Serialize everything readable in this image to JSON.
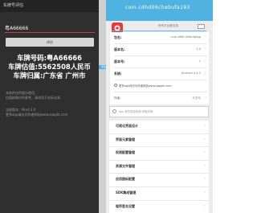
{
  "left_app": {
    "title": "车牌号评估",
    "plate_input_value": "粤A66666",
    "evaluate_button": "评估",
    "result_plate": "车牌号码:粤A66666",
    "result_value": "车牌估值:5562508人民币",
    "result_region": "车牌归属:广东省 广州市",
    "disclaimer": [
      "本软件仅供娱乐使用，",
      "估值结果仅供参考，请勿用于实际交易"
    ],
    "footer": [
      "当前版本：Pkxd 3.0",
      "更多app请访问作者网站www.zqaphr.com"
    ]
  },
  "strip": {
    "tag": "评估"
  },
  "right_panel": {
    "header_text": "com.cdhd06chebufa193",
    "switch_label": "所有平台都支持",
    "info_rows": [
      {
        "label": "包名:",
        "value": "com.dfbh.dhdb4pfgg"
      },
      {
        "label": "版本名:",
        "value": "1.0"
      },
      {
        "label": "版本号:",
        "value": "1"
      },
      {
        "label": "系统:",
        "value": "Android 4.4.2"
      }
    ],
    "website_text": "更多app请访问作者网站www.zqaphr.com",
    "footer_label": "作者:",
    "footer_value": "未发布",
    "search_text": "app 软件信息查询 获取详情",
    "menu_items": [
      "可视化界面设计",
      "界面元素管理",
      "权限配置管理",
      "资源文件管理",
      "应用图标配置",
      "SDK集成管理",
      "程序签名设置"
    ]
  },
  "colors": {
    "accent_blue": "#4fb2e0",
    "input_underline": "#c24040",
    "dark_bg": "#2f2f2f"
  },
  "icons": [
    "search-icon",
    "chevron-right-icon",
    "globe-icon",
    "app-logo-icon",
    "toggle-icon"
  ]
}
